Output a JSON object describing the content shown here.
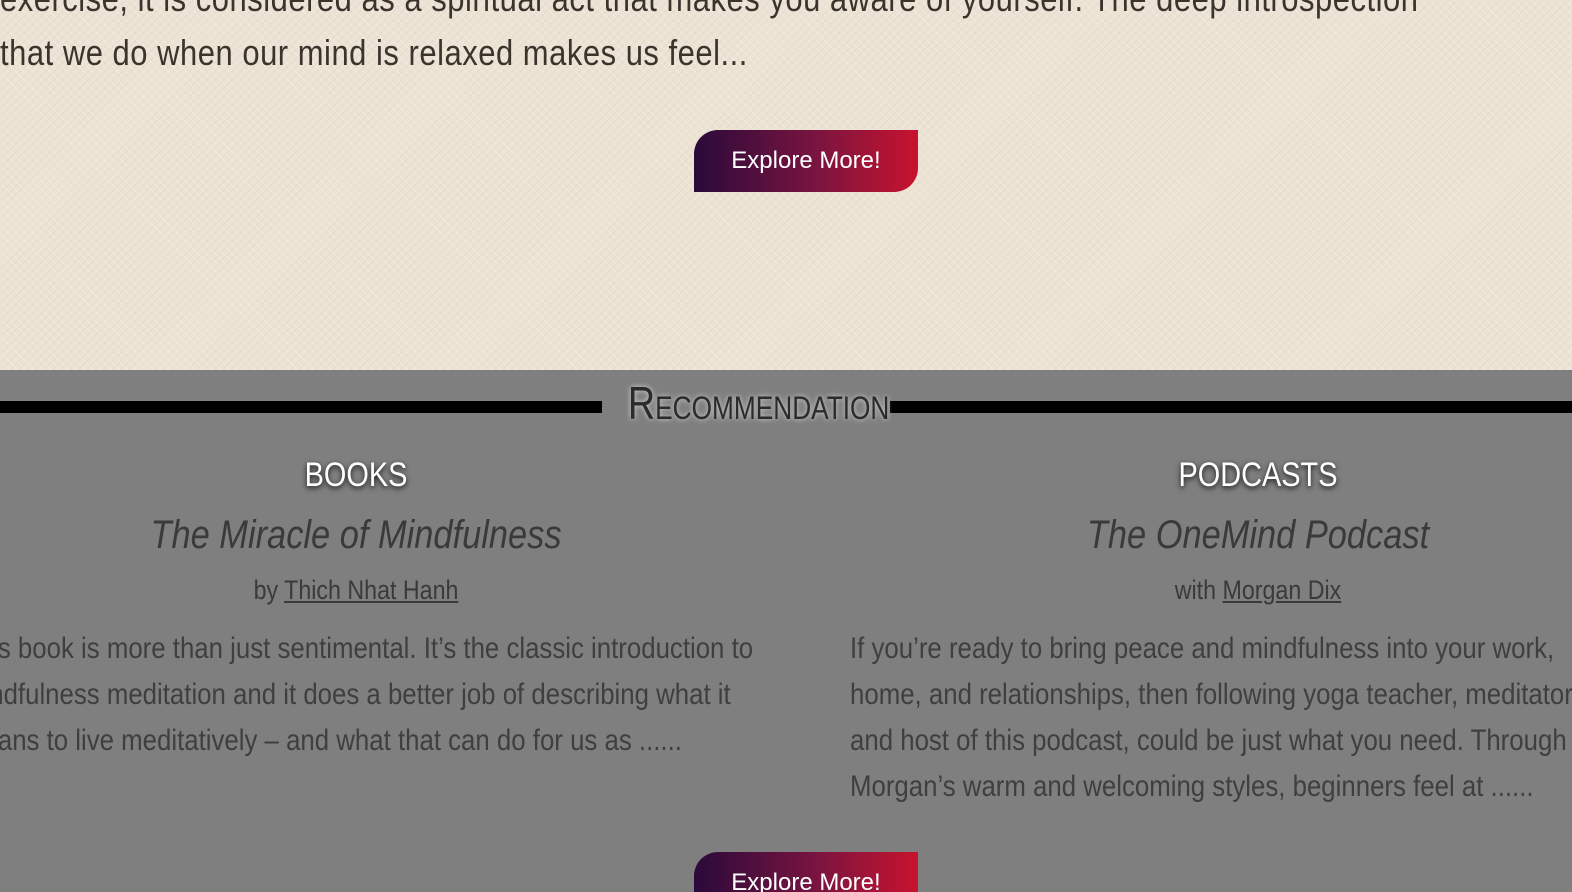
{
  "intro": {
    "lines": [
      "exercise, it is considered as a spiritual act that makes you aware of yourself. The deep introspection",
      "that we do when our mind is relaxed makes us feel..."
    ],
    "button_label": "Explore More!"
  },
  "recommendation": {
    "title": "Recommendation",
    "books": {
      "heading": "BOOKS",
      "title": "The Miracle of Mindfulness",
      "credit_prefix": "by ",
      "author": "Thich Nhat Hanh",
      "description": [
        "This book is more than just sentimental. It’s the classic introduction to",
        "mindfulness meditation and it does a better job of describing what it",
        "means to live meditatively – and what that can do for us as ......"
      ]
    },
    "podcasts": {
      "heading": "PODCASTS",
      "title": "The OneMind Podcast",
      "credit_prefix": "with ",
      "host": "Morgan Dix",
      "description": [
        "If you’re ready to bring peace and mindfulness into your work,",
        "home, and relationships, then following yoga teacher, meditator,",
        "and host of this podcast, could be just what you need. Through",
        "Morgan’s warm and welcoming styles, beginners feel at ......"
      ]
    },
    "button_label": "Explore More!"
  },
  "colors": {
    "intro_bg": "#ece3d4",
    "rec_bg": "#7f7f7f",
    "button_gradient_start": "#2a0a3a",
    "button_gradient_end": "#c8132e"
  }
}
